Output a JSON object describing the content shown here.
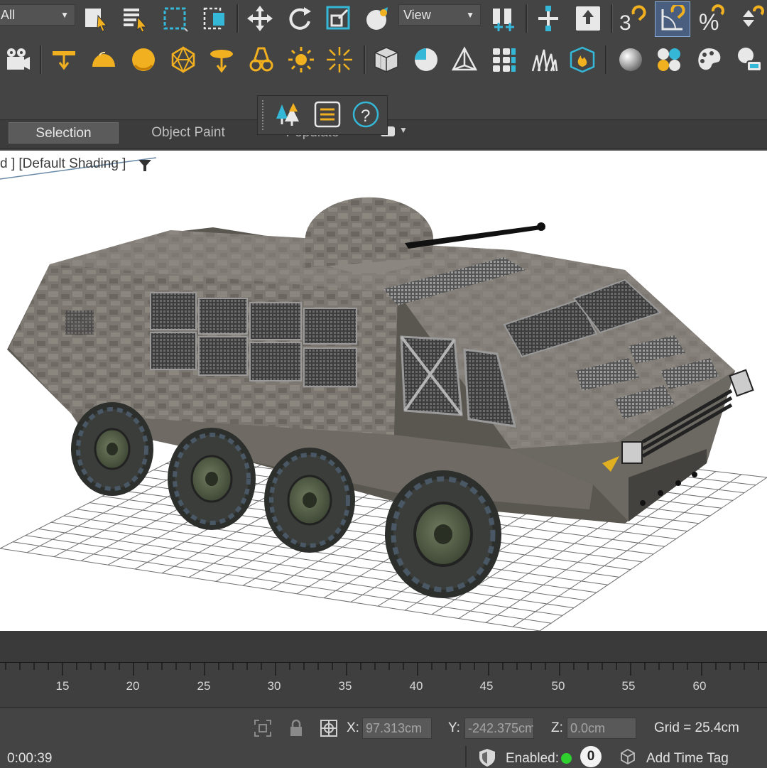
{
  "main_toolbar": {
    "selection_filter": "All",
    "reference_coord": "View",
    "icons": [
      "select-object-icon",
      "select-by-name-icon",
      "rectangular-selection-icon",
      "window-crossing-icon",
      "select-and-move-icon",
      "select-and-rotate-icon",
      "select-and-scale-icon",
      "select-manipulate-icon",
      "use-pivot-icon",
      "select-and-link-icon",
      "keyboard-shortcut-icon",
      "snaps-toggle-icon",
      "angle-snap-icon",
      "percent-snap-icon",
      "spinner-snap-icon"
    ]
  },
  "create_toolbar": {
    "icons": [
      "camera-icon",
      "target-spot-light-icon",
      "dome-light-icon",
      "sphere-light-icon",
      "geosphere-icon",
      "free-spot-icon",
      "omni-light-icon",
      "sun-icon",
      "skylight-icon",
      "box-icon",
      "sphere-object-icon",
      "pyramid-icon",
      "array-icon",
      "foliage-icon",
      "fire-effect-icon",
      "material-sphere-icon",
      "material-editor-icon",
      "color-palette-icon",
      "render-setup-icon"
    ]
  },
  "ribbon": {
    "tabs": [
      {
        "label": "Selection",
        "active": true
      },
      {
        "label": "Object Paint",
        "active": false
      },
      {
        "label": "Populate",
        "active": false
      }
    ],
    "populate_panel_icons": [
      "trees-icon",
      "list-icon",
      "help-icon"
    ]
  },
  "viewport": {
    "label": "d ] [Default Shading ]",
    "colors": {
      "background": "#ffffff",
      "grid": "#6e6e6e",
      "hull": "#7b7670"
    }
  },
  "timeline": {
    "ticks": [
      "15",
      "20",
      "25",
      "30",
      "35",
      "40",
      "45",
      "50",
      "55",
      "60"
    ]
  },
  "status": {
    "x_label": "X:",
    "x_value": "97.313cm",
    "y_label": "Y:",
    "y_value": "-242.375cm",
    "z_label": "Z:",
    "z_value": "0.0cm",
    "grid": "Grid = 25.4cm",
    "time": "0:00:39",
    "enabled_label": "Enabled:",
    "enabled_color": "#2fd12f",
    "counter": "0",
    "add_time_tag": "Add Time Tag"
  }
}
